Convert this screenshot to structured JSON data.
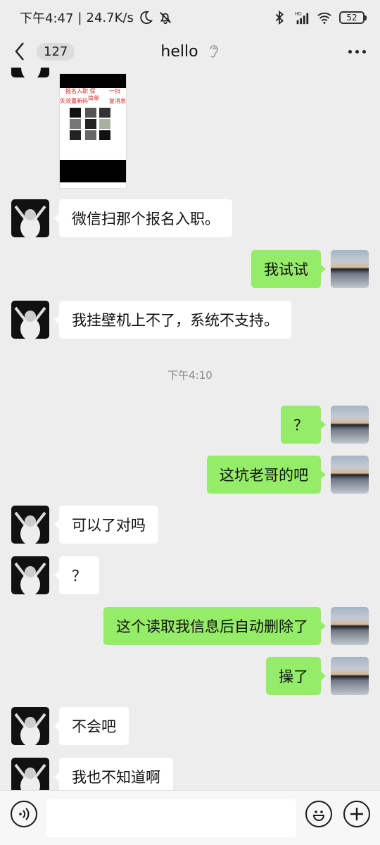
{
  "status_bar": {
    "time": "下午4:47",
    "speed": "24.7K/s",
    "battery": "52",
    "icons": [
      "moon-icon",
      "mute-icon",
      "bluetooth-icon",
      "hd-signal-icon",
      "wifi-icon",
      "battery-icon"
    ]
  },
  "nav": {
    "back_count": "127",
    "title": "hello",
    "icons": [
      "chevron-left-icon",
      "ear-icon",
      "more-icon"
    ]
  },
  "image_message": {
    "line1": "报名入职 保",
    "line2": "一扫",
    "line3": "简单",
    "line4": "失效重新码",
    "line5": "复消息"
  },
  "messages": [
    {
      "side": "in",
      "text": "微信扫那个报名入职。"
    },
    {
      "side": "out",
      "text": "我试试"
    },
    {
      "side": "in",
      "text": "我挂壁机上不了，系统不支持。"
    },
    {
      "side": "out",
      "text": "？"
    },
    {
      "side": "out",
      "text": "这坑老哥的吧"
    },
    {
      "side": "in",
      "text": "可以了对吗"
    },
    {
      "side": "in",
      "text": "？"
    },
    {
      "side": "out",
      "text": "这个读取我信息后自动删除了"
    },
    {
      "side": "out",
      "text": "操了"
    },
    {
      "side": "in",
      "text": "不会吧"
    },
    {
      "side": "in",
      "text": "我也不知道啊"
    }
  ],
  "timestamp": "下午4:10",
  "input_bar": {
    "value": "",
    "icons": [
      "voice-icon",
      "emoji-icon",
      "plus-icon"
    ]
  },
  "colors": {
    "background": "#ededed",
    "outgoing_bubble": "#95ec69",
    "incoming_bubble": "#ffffff"
  }
}
